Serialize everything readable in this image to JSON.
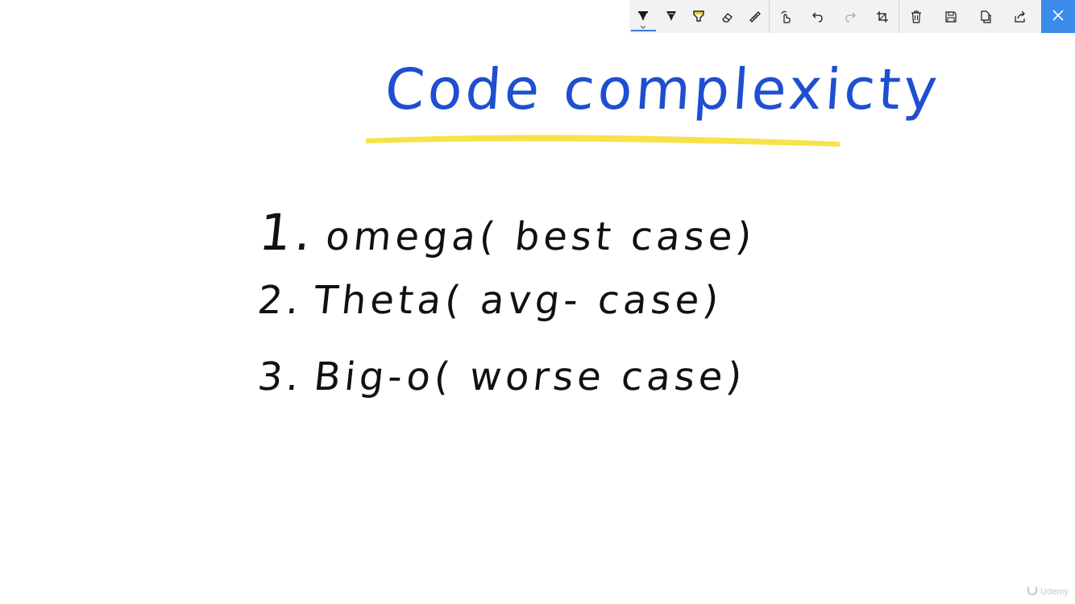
{
  "toolbar": {
    "tools": [
      {
        "icon": "ballpoint-pen-icon",
        "active": true
      },
      {
        "icon": "pencil-icon",
        "active": false
      },
      {
        "icon": "highlighter-icon",
        "active": false
      },
      {
        "icon": "eraser-icon",
        "active": false
      },
      {
        "icon": "ruler-icon",
        "active": false
      }
    ],
    "actions": [
      {
        "icon": "touch-writing-icon"
      },
      {
        "icon": "undo-icon"
      },
      {
        "icon": "redo-icon"
      },
      {
        "icon": "crop-icon"
      }
    ],
    "file": [
      {
        "icon": "delete-icon"
      },
      {
        "icon": "save-icon"
      },
      {
        "icon": "copy-icon"
      },
      {
        "icon": "share-icon"
      }
    ],
    "close_icon": "close-icon",
    "accent_color": "#3b8beb"
  },
  "canvas": {
    "title": "Code complexicty",
    "title_color": "#1f4fd1",
    "highlight_color": "#f7e24a",
    "items": [
      {
        "number": "1.",
        "text": "omega( best case)"
      },
      {
        "number": "2.",
        "text": "Theta( avg- case)"
      },
      {
        "number": "3.",
        "text": "Big-o( worse case)"
      }
    ],
    "ink_color": "#111111"
  },
  "watermark": {
    "text": "Udemy"
  }
}
